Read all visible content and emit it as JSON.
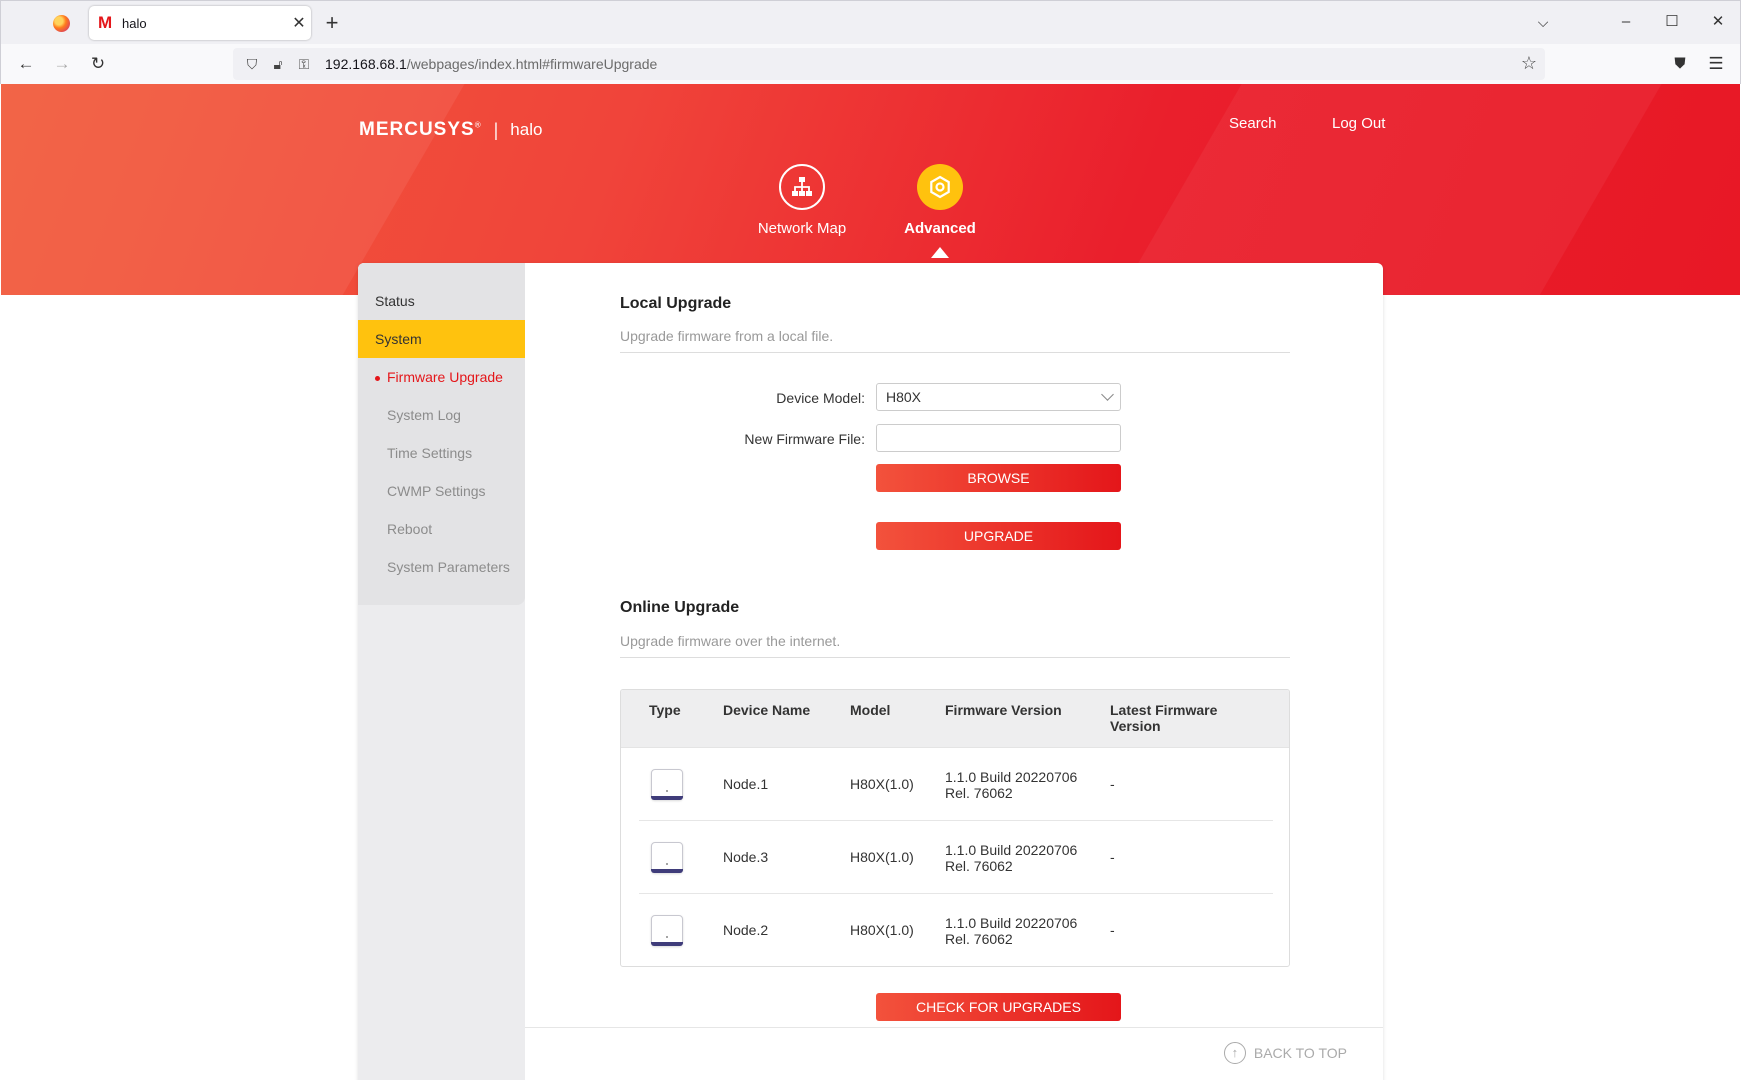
{
  "browser": {
    "tab_title": "halo",
    "url_host": "192.168.68.1",
    "url_path": "/webpages/index.html#firmwareUpgrade"
  },
  "header": {
    "brand": "MERCUSYS",
    "trademark": "®",
    "separator": "|",
    "product": "halo",
    "search_label": "Search",
    "logout_label": "Log Out"
  },
  "modes": {
    "network_map": "Network Map",
    "advanced": "Advanced"
  },
  "sidebar": {
    "status": "Status",
    "system": "System",
    "sub_items": {
      "firmware_upgrade": "Firmware Upgrade",
      "system_log": "System Log",
      "time_settings": "Time Settings",
      "cwmp_settings": "CWMP Settings",
      "reboot": "Reboot",
      "system_parameters": "System Parameters"
    }
  },
  "local_upgrade": {
    "title": "Local Upgrade",
    "description": "Upgrade firmware from a local file.",
    "device_model_label": "Device Model:",
    "device_model_value": "H80X",
    "firmware_file_label": "New Firmware File:",
    "firmware_file_value": "",
    "browse_label": "BROWSE",
    "upgrade_label": "UPGRADE"
  },
  "online_upgrade": {
    "title": "Online Upgrade",
    "description": "Upgrade firmware over the internet.",
    "columns": {
      "type": "Type",
      "device_name": "Device Name",
      "model": "Model",
      "firmware_version": "Firmware Version",
      "latest_line1": "Latest Firmware",
      "latest_line2": "Version"
    },
    "rows": [
      {
        "device_name": "Node.1",
        "model": "H80X(1.0)",
        "fw_line1": "1.1.0 Build 20220706",
        "fw_line2": "Rel. 76062",
        "latest": "-"
      },
      {
        "device_name": "Node.3",
        "model": "H80X(1.0)",
        "fw_line1": "1.1.0 Build 20220706",
        "fw_line2": "Rel. 76062",
        "latest": "-"
      },
      {
        "device_name": "Node.2",
        "model": "H80X(1.0)",
        "fw_line1": "1.1.0 Build 20220706",
        "fw_line2": "Rel. 76062",
        "latest": "-"
      }
    ],
    "check_label": "CHECK FOR UPGRADES"
  },
  "footer": {
    "back_to_top": "BACK TO TOP"
  },
  "icons": {
    "network_map": "network-map-icon",
    "advanced": "gear-icon",
    "device": "mesh-node-icon",
    "back_to_top": "arrow-up-circle-icon"
  },
  "colors": {
    "brand_red": "#e4161a",
    "accent_yellow": "#ffc20e"
  }
}
